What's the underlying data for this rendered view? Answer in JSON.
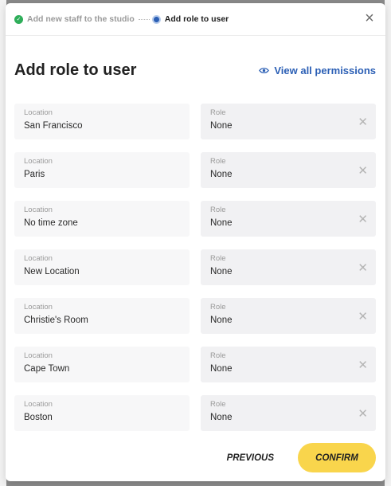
{
  "steps": [
    {
      "label": "Add new staff to the studio",
      "state": "done"
    },
    {
      "label": "Add role to user",
      "state": "active"
    }
  ],
  "title": "Add role to user",
  "view_permissions_label": "View all permissions",
  "location_label": "Location",
  "role_label": "Role",
  "rows": [
    {
      "location": "San Francisco",
      "role": "None"
    },
    {
      "location": "Paris",
      "role": "None"
    },
    {
      "location": "No time zone",
      "role": "None"
    },
    {
      "location": "New Location",
      "role": "None"
    },
    {
      "location": "Christie's Room",
      "role": "None"
    },
    {
      "location": "Cape Town",
      "role": "None"
    },
    {
      "location": "Boston",
      "role": "None"
    }
  ],
  "footer": {
    "previous_label": "PREVIOUS",
    "confirm_label": "CONFIRM"
  },
  "colors": {
    "accent": "#2b5fb5",
    "confirm": "#f9d54c",
    "done": "#2fae5a"
  },
  "icons": {
    "close": "close-icon",
    "eye": "eye-icon",
    "clear": "clear-icon"
  }
}
